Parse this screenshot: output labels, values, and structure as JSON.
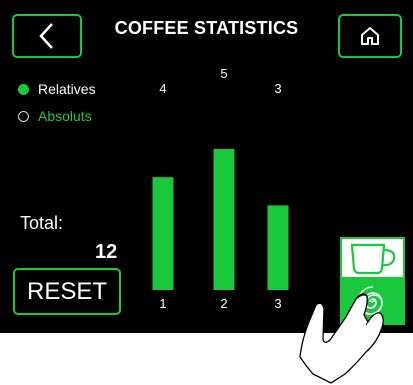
{
  "header": {
    "title": "COFFEE STATISTICS",
    "back_icon": "chevron-left-icon",
    "home_icon": "home-icon"
  },
  "mode": {
    "options": [
      {
        "label": "Relatives",
        "selected": true
      },
      {
        "label": "Absoluts",
        "selected": false
      }
    ]
  },
  "summary": {
    "total_label": "Total:",
    "total_value": "12"
  },
  "reset_label": "RESET",
  "tiles": {
    "cup_icon": "coffee-cup-icon",
    "swirl_icon": "swirl-icon"
  },
  "colors": {
    "accent": "#19c83c",
    "background": "#000000",
    "text": "#ffffff"
  },
  "chart_data": {
    "type": "bar",
    "categories": [
      "1",
      "2",
      "3"
    ],
    "values": [
      4,
      5,
      3
    ],
    "ylim": [
      0,
      5
    ],
    "grid": false
  }
}
